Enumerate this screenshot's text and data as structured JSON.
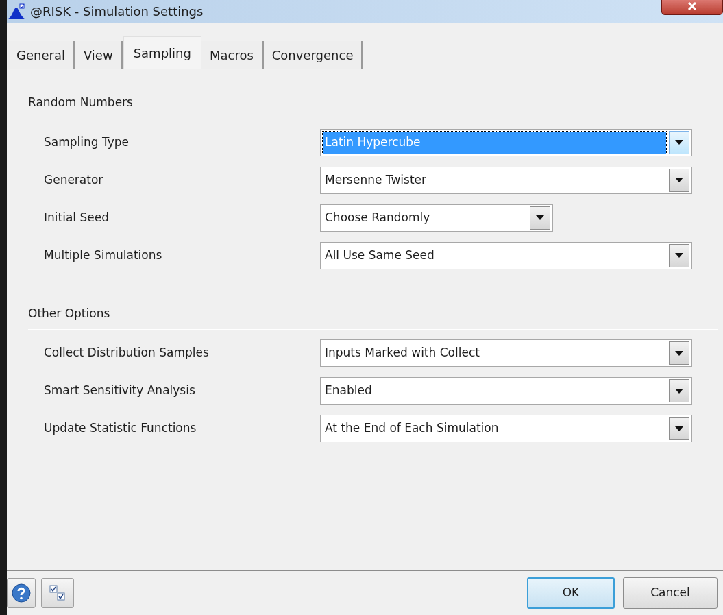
{
  "window": {
    "title": "@RISK - Simulation Settings"
  },
  "tabs": [
    {
      "label": "General",
      "selected": false
    },
    {
      "label": "View",
      "selected": false
    },
    {
      "label": "Sampling",
      "selected": true
    },
    {
      "label": "Macros",
      "selected": false
    },
    {
      "label": "Convergence",
      "selected": false
    }
  ],
  "sections": [
    {
      "title": "Random Numbers",
      "rows": [
        {
          "label": "Sampling Type",
          "value": "Latin Hypercube",
          "focused": true,
          "kind": "wide"
        },
        {
          "label": "Generator",
          "value": "Mersenne Twister",
          "focused": false,
          "kind": "wide"
        },
        {
          "label": "Initial Seed",
          "value": "Choose Randomly",
          "focused": false,
          "kind": "narrow"
        },
        {
          "label": "Multiple Simulations",
          "value": "All Use Same Seed",
          "focused": false,
          "kind": "wide"
        }
      ]
    },
    {
      "title": "Other Options",
      "rows": [
        {
          "label": "Collect Distribution Samples",
          "value": "Inputs Marked with Collect",
          "focused": false,
          "kind": "wide"
        },
        {
          "label": "Smart Sensitivity Analysis",
          "value": "Enabled",
          "focused": false,
          "kind": "wide"
        },
        {
          "label": "Update Statistic Functions",
          "value": "At the End of Each Simulation",
          "focused": false,
          "kind": "wide"
        }
      ]
    }
  ],
  "buttons": [
    {
      "label": "OK",
      "default": true
    },
    {
      "label": "Cancel",
      "default": false
    }
  ]
}
